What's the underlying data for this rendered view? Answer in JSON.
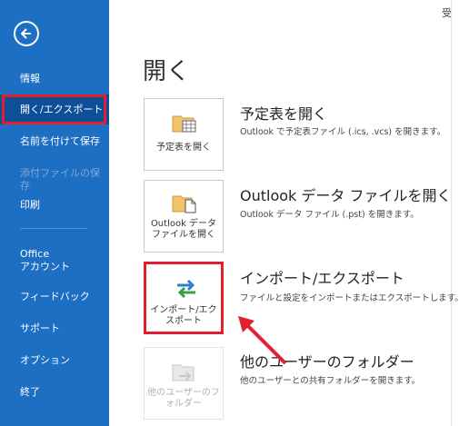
{
  "sidebar": {
    "items": [
      {
        "label": "情報"
      },
      {
        "label": "開く/エクスポート"
      },
      {
        "label": "名前を付けて保存"
      },
      {
        "label": "添付ファイルの保存"
      },
      {
        "label": "印刷"
      },
      {
        "label": "Office\nアカウント"
      },
      {
        "label": "フィードバック"
      },
      {
        "label": "サポート"
      },
      {
        "label": "オプション"
      },
      {
        "label": "終了"
      }
    ]
  },
  "main": {
    "title": "開く",
    "corner_text": "受",
    "options": [
      {
        "tile_label": "予定表を開く",
        "title": "予定表を開く",
        "desc": "Outlook で予定表ファイル (.ics, .vcs) を開きます。",
        "icon": "folder-calendar-icon"
      },
      {
        "tile_label": "Outlook データ ファイルを開く",
        "title": "Outlook データ ファイルを開く",
        "desc": "Outlook データ ファイル (.pst) を開きます。",
        "icon": "folder-file-icon"
      },
      {
        "tile_label": "インポート/エクスポート",
        "title": "インポート/エクスポート",
        "desc": "ファイルと設定をインポートまたはエクスポートします。",
        "icon": "import-export-arrows-icon"
      },
      {
        "tile_label": "他のユーザーのフォルダー",
        "title": "他のユーザーのフォルダー",
        "desc": "他のユーザーとの共有フォルダーを開きます。",
        "icon": "shared-folder-icon"
      }
    ]
  },
  "colors": {
    "sidebar": "#1d6fc4",
    "selected": "#0d4f98",
    "highlight": "#e0202a"
  }
}
